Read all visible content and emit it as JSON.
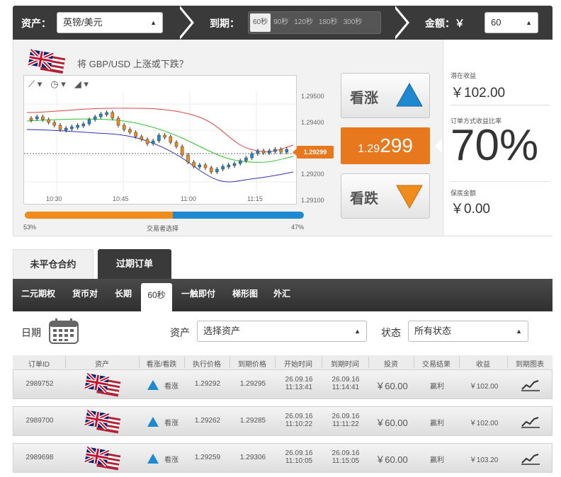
{
  "topbar": {
    "asset_label": "资产：",
    "asset_value": "英镑/美元",
    "expiry_label": "到期：",
    "time_options": [
      "60秒",
      "90秒",
      "120秒",
      "180秒",
      "300秒"
    ],
    "amount_label": "金额：￥",
    "amount_value": "60"
  },
  "trade": {
    "question": "将 GBP/USD 上涨或下跌？",
    "up_label": "看涨",
    "down_label": "看跌",
    "price_small": "1.29",
    "price_large": "299",
    "price_tag": "1.29299",
    "potential_label": "潜在收益",
    "potential_value": "￥102.00",
    "rate_label": "订单方式收益比率",
    "rate_value": "70%",
    "guarantee_label": "保底金额",
    "guarantee_value": "￥0.00",
    "sentiment_left": "53%",
    "sentiment_mid": "交易者选择",
    "sentiment_right": "47%",
    "sentiment_fraction": 0.53
  },
  "chart": {
    "y_ticks": [
      "1.29500",
      "1.29400",
      "1.29300",
      "1.29200",
      "1.29100"
    ],
    "x_ticks": [
      "10:30",
      "10:45",
      "11:00",
      "11:15"
    ]
  },
  "tabs": {
    "open": "未平仓合约",
    "expired": "过期订单"
  },
  "subnav": [
    "二元期权",
    "货币对",
    "长期",
    "60秒",
    "一触即付",
    "梯形图",
    "外汇"
  ],
  "filters": {
    "date_label": "日期",
    "asset_label": "资产",
    "asset_value": "选择资产",
    "status_label": "状态",
    "status_value": "所有状态"
  },
  "table": {
    "headers": [
      "订单ID",
      "资产",
      "看涨/看跌",
      "执行价格",
      "到期价格",
      "开始时间",
      "到期时间",
      "投资",
      "交易结果",
      "收益",
      "到期图表"
    ],
    "rows": [
      {
        "id": "2989752",
        "dir": "看涨",
        "strike": "1.29292",
        "expiry_price": "1.29295",
        "start_date": "26.09.16",
        "start_time": "11:13:41",
        "end_date": "26.09.16",
        "end_time": "11:14:41",
        "invest": "￥60.00",
        "result": "赢利",
        "profit": "￥102.00"
      },
      {
        "id": "2989700",
        "dir": "看涨",
        "strike": "1.29262",
        "expiry_price": "1.29285",
        "start_date": "26.09.16",
        "start_time": "11:10:22",
        "end_date": "26.09.16",
        "end_time": "11:11:22",
        "invest": "￥60.00",
        "result": "赢利",
        "profit": "￥102.00"
      },
      {
        "id": "2989698",
        "dir": "看涨",
        "strike": "1.29259",
        "expiry_price": "1.29306",
        "start_date": "26.09.16",
        "start_time": "11:10:05",
        "end_date": "26.09.16",
        "end_time": "11:15:05",
        "invest": "￥60.00",
        "result": "赢利",
        "profit": "￥103.20"
      }
    ]
  },
  "colors": {
    "accent": "#e8781e",
    "dark": "#3a3a3a",
    "up": "#1e88d0",
    "down": "#f08c1c"
  }
}
